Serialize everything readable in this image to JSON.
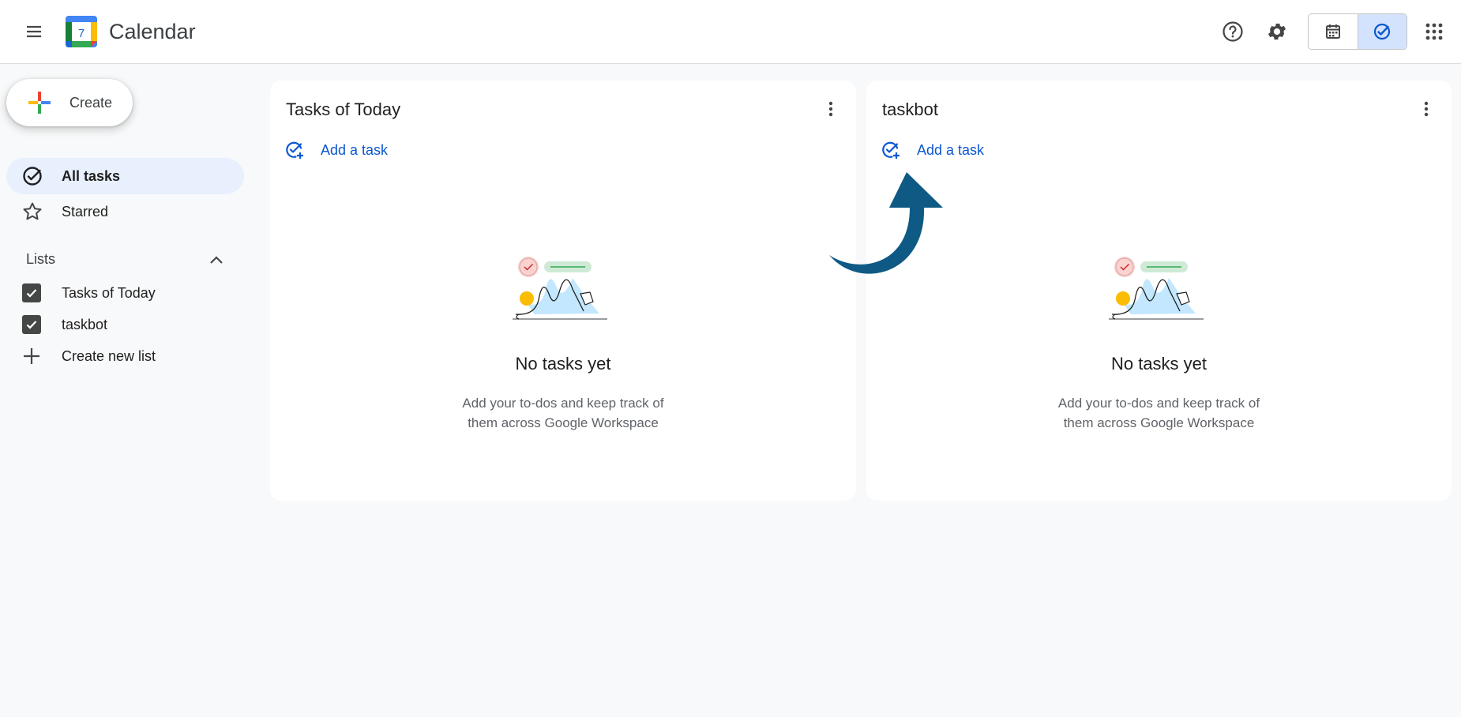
{
  "header": {
    "app_title": "Calendar",
    "logo_day": "7",
    "icons": {
      "menu": "menu-icon",
      "help": "help-icon",
      "settings": "gear-icon",
      "calendar_view": "calendar-icon",
      "tasks_view": "tasks-check-icon",
      "apps": "apps-grid-icon"
    }
  },
  "sidebar": {
    "create_label": "Create",
    "nav": [
      {
        "label": "All tasks",
        "icon": "check-circle-icon",
        "active": true
      },
      {
        "label": "Starred",
        "icon": "star-icon",
        "active": false
      }
    ],
    "lists_heading": "Lists",
    "lists": [
      {
        "label": "Tasks of Today",
        "checked": true
      },
      {
        "label": "taskbot",
        "checked": true
      }
    ],
    "create_list_label": "Create new list"
  },
  "cards": [
    {
      "title": "Tasks of Today",
      "add_task_label": "Add a task",
      "empty_title": "No tasks yet",
      "empty_line1": "Add your to-dos and keep track of",
      "empty_line2": "them across Google Workspace"
    },
    {
      "title": "taskbot",
      "add_task_label": "Add a task",
      "empty_title": "No tasks yet",
      "empty_line1": "Add your to-dos and keep track of",
      "empty_line2": "them across Google Workspace"
    }
  ],
  "colors": {
    "accent_blue": "#0b57d0",
    "active_nav_bg": "#e8f0fe",
    "annotation_arrow": "#0e5a85"
  }
}
